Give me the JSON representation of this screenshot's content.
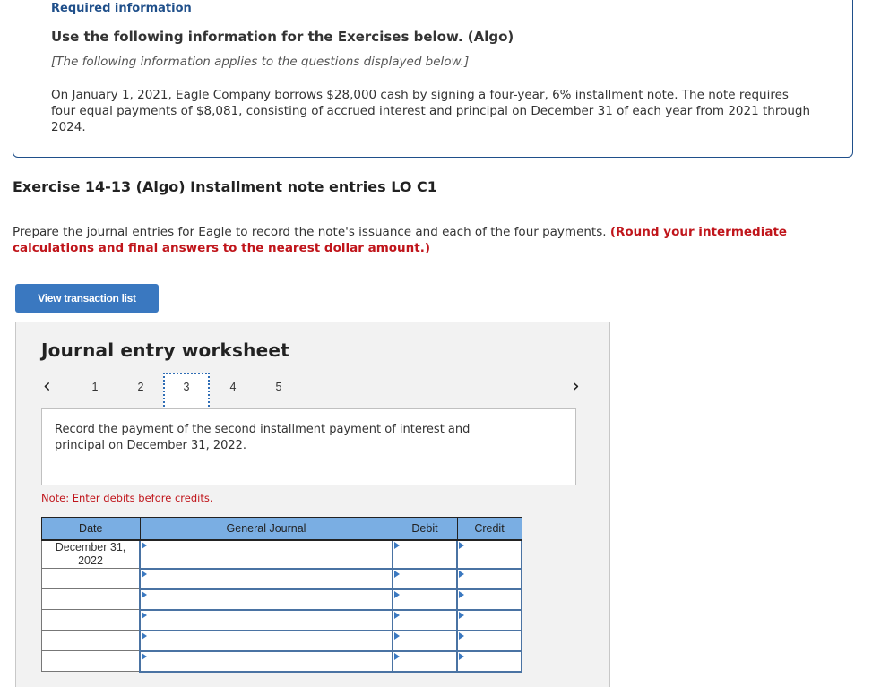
{
  "required_info": {
    "label": "Required information",
    "heading": "Use the following information for the Exercises below. (Algo)",
    "subheading": "[The following information applies to the questions displayed below.]",
    "body": "On January 1, 2021, Eagle Company borrows $28,000 cash by signing a four-year, 6% installment note. The note requires four equal payments of $8,081, consisting of accrued interest and principal on December 31 of each year from 2021 through 2024."
  },
  "exercise": {
    "title": "Exercise 14-13 (Algo) Installment note entries LO C1",
    "instructions": "Prepare the journal entries for Eagle to record the note's issuance and each of the four payments. ",
    "instructions_emphasis": "(Round your intermediate calculations and final answers to the nearest dollar amount.)"
  },
  "view_transaction_button": "View transaction list",
  "worksheet": {
    "title": "Journal entry worksheet",
    "prev_icon": "chevron-left",
    "next_icon": "chevron-right",
    "tabs": [
      {
        "label": "1",
        "active": false
      },
      {
        "label": "2",
        "active": false
      },
      {
        "label": "3",
        "active": true
      },
      {
        "label": "4",
        "active": false
      },
      {
        "label": "5",
        "active": false
      }
    ],
    "prompt": "Record the payment of the second installment payment of interest and principal on December 31, 2022.",
    "note": "Note: Enter debits before credits.",
    "table": {
      "headers": [
        "Date",
        "General Journal",
        "Debit",
        "Credit"
      ],
      "rows": [
        {
          "date": "December 31, 2022",
          "account": "",
          "debit": "",
          "credit": ""
        },
        {
          "date": "",
          "account": "",
          "debit": "",
          "credit": ""
        },
        {
          "date": "",
          "account": "",
          "debit": "",
          "credit": ""
        },
        {
          "date": "",
          "account": "",
          "debit": "",
          "credit": ""
        },
        {
          "date": "",
          "account": "",
          "debit": "",
          "credit": ""
        },
        {
          "date": "",
          "account": "",
          "debit": "",
          "credit": ""
        }
      ]
    }
  }
}
